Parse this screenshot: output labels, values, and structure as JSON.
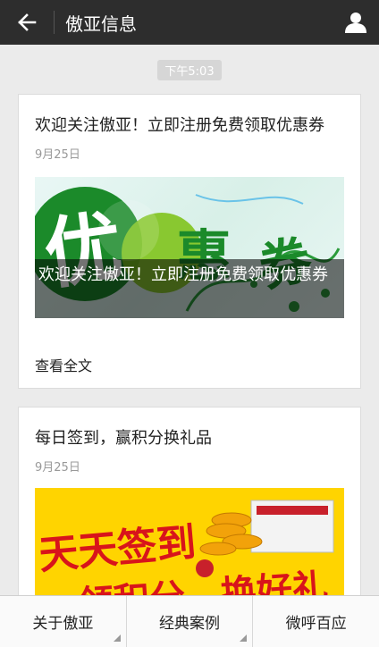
{
  "header": {
    "title": "傲亚信息",
    "back_icon": "back-arrow-icon",
    "user_icon": "user-icon"
  },
  "time_label": "下午5:03",
  "articles": [
    {
      "title": "欢迎关注傲亚！立即注册免费领取优惠券",
      "date": "9月25日",
      "banner_overlay": "欢迎关注傲亚！立即注册免费领取优惠券",
      "banner_text_1": "优",
      "banner_text_2": "惠",
      "banner_text_3": "券",
      "read_more": "查看全文"
    },
    {
      "title": "每日签到，赢积分换礼品",
      "date": "9月25日",
      "banner_line_1": "天天签到",
      "banner_line_2": "领积分，换好礼"
    }
  ],
  "bottom_menu": [
    "关于傲亚",
    "经典案例",
    "微呼百应"
  ],
  "colors": {
    "topbar": "#2d2d2d",
    "green": "#1b8a2a",
    "yellow_banner": "#ffd400",
    "red_text": "#d8141b"
  }
}
